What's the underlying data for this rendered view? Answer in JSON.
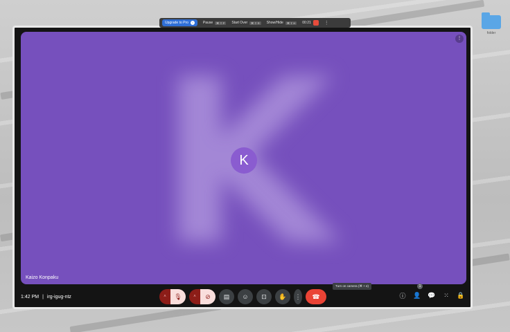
{
  "desktop": {
    "folder_label": "folder"
  },
  "recorder_bar": {
    "upgrade_label": "Upgrade to Pro",
    "upgrade_icon": "info-icon",
    "pause_label": "Pause",
    "pause_key": "⌘ ⇧ P",
    "start_over_label": "Start Over",
    "start_over_key": "⌘ ⇧ R",
    "show_hide_label": "Show/Hide",
    "show_hide_key": "⌘ ⇧ H",
    "timer": "00:21",
    "stop_icon": "stop-icon",
    "more_icon": "more-icon"
  },
  "meeting": {
    "avatar_initial": "K",
    "participant_name": "Kaizo Konpaku",
    "time": "1:42 PM",
    "separator": "|",
    "code": "irg-igug-ntz",
    "camera_tooltip": "Turn on camera (⌘ + e)",
    "participants_count": "1"
  },
  "icons": {
    "mic_off": "microphone-off-icon",
    "cam_off": "camera-off-icon",
    "captions": "captions-icon",
    "emoji": "emoji-icon",
    "present": "present-screen-icon",
    "raise_hand": "raise-hand-icon",
    "more": "more-options-icon",
    "end_call": "end-call-icon",
    "info": "info-icon",
    "people": "people-icon",
    "chat": "chat-icon",
    "activities": "activities-icon",
    "host_controls": "host-controls-icon"
  },
  "colors": {
    "tile_background": "#7650bd",
    "end_call": "#ea4335",
    "muted_background": "#8c1d18",
    "upgrade_blue": "#2f6fd6"
  }
}
